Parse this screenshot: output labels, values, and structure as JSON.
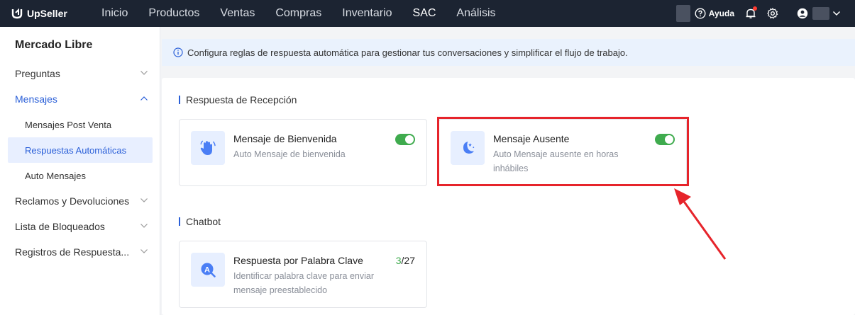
{
  "brand": {
    "name": "UpSeller"
  },
  "nav": {
    "items": [
      {
        "label": "Inicio"
      },
      {
        "label": "Productos"
      },
      {
        "label": "Ventas"
      },
      {
        "label": "Compras"
      },
      {
        "label": "Inventario"
      },
      {
        "label": "SAC"
      },
      {
        "label": "Análisis"
      }
    ],
    "active": "SAC",
    "help_label": "Ayuda"
  },
  "sidebar": {
    "title": "Mercado Libre",
    "items": [
      {
        "label": "Preguntas"
      },
      {
        "label": "Mensajes"
      },
      {
        "label": "Reclamos y Devoluciones"
      },
      {
        "label": "Lista de Bloqueados"
      },
      {
        "label": "Registros de Respuesta..."
      }
    ],
    "subitems": [
      {
        "label": "Mensajes Post Venta"
      },
      {
        "label": "Respuestas Automáticas"
      },
      {
        "label": "Auto Mensajes"
      }
    ]
  },
  "banner": {
    "text": "Configura reglas de respuesta automática para gestionar tus conversaciones y simplificar el flujo de trabajo."
  },
  "sections": {
    "reception": {
      "title": "Respuesta de Recepción",
      "cards": [
        {
          "title": "Mensaje de Bienvenida",
          "desc": "Auto Mensaje de bienvenida",
          "enabled": true
        },
        {
          "title": "Mensaje Ausente",
          "desc": "Auto Mensaje ausente en horas inhábiles",
          "enabled": true
        }
      ]
    },
    "chatbot": {
      "title": "Chatbot",
      "cards": [
        {
          "title": "Respuesta por Palabra Clave",
          "desc": "Identificar palabra clave para enviar mensaje preestablecido",
          "count_used": "3",
          "count_total": "/27"
        }
      ]
    }
  },
  "colors": {
    "accent": "#2a5fd8",
    "toggle_on": "#3fab4e",
    "highlight": "#e6242b",
    "topbar": "#1c2432"
  }
}
